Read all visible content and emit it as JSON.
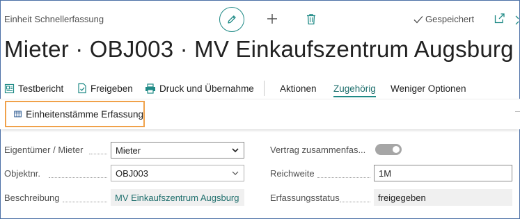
{
  "header": {
    "page_type": "Einheit Schnellerfassung",
    "saved_status": "Gespeichert",
    "title": "Mieter · OBJ003 · MV Einkaufszentrum Augsburg"
  },
  "actions": {
    "testbericht": "Testbericht",
    "freigeben": "Freigeben",
    "druck": "Druck und Übernahme",
    "aktionen": "Aktionen",
    "zugehoerig": "Zugehörig",
    "weniger": "Weniger Optionen"
  },
  "subaction": {
    "label": "Einheitenstämme Erfassung"
  },
  "fields": {
    "eigentuemer_label": "Eigentümer / Mieter",
    "eigentuemer_value": "Mieter",
    "objektnr_label": "Objektnr.",
    "objektnr_value": "OBJ003",
    "beschreibung_label": "Beschreibung",
    "beschreibung_value": "MV Einkaufszentrum Augsburg",
    "vertrag_label": "Vertrag zusammenfas...",
    "reichweite_label": "Reichweite",
    "reichweite_value": "1M",
    "status_label": "Erfassungsstatus",
    "status_value": "freigegeben"
  },
  "colors": {
    "accent": "#1f8a86",
    "highlight_border": "#f0a14a",
    "toggle_off": "#a6a6a6"
  }
}
